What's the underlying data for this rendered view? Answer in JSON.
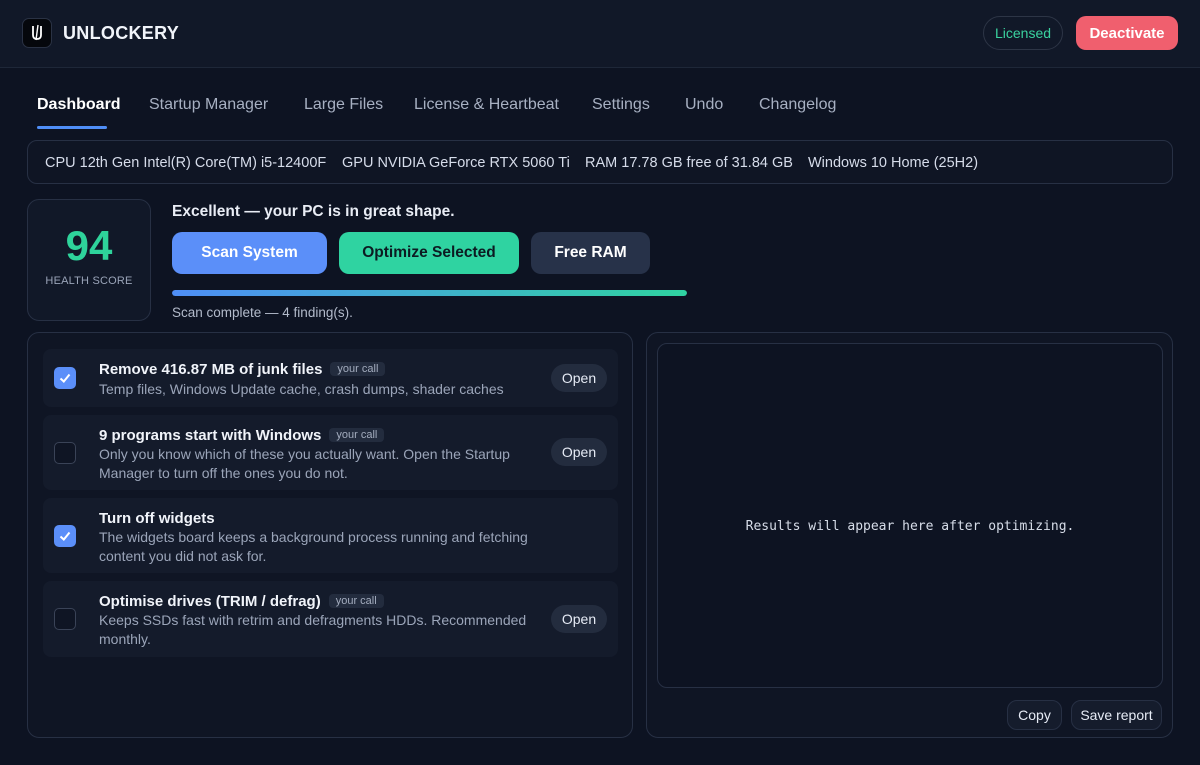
{
  "app": {
    "title": "UNLOCKERY",
    "license_status": "Licensed",
    "deactivate_label": "Deactivate",
    "colors": {
      "accent_blue": "#5b8ff9",
      "accent_green": "#2fd3a1",
      "danger": "#f05f6e",
      "background": "#0d1322"
    }
  },
  "tabs": [
    {
      "label": "Dashboard",
      "active": true
    },
    {
      "label": "Startup Manager",
      "active": false
    },
    {
      "label": "Large Files",
      "active": false
    },
    {
      "label": "License & Heartbeat",
      "active": false
    },
    {
      "label": "Settings",
      "active": false
    },
    {
      "label": "Undo",
      "active": false
    },
    {
      "label": "Changelog",
      "active": false
    }
  ],
  "system_info": {
    "cpu": "CPU  12th Gen Intel(R) Core(TM) i5-12400F",
    "gpu": "GPU  NVIDIA GeForce RTX 5060 Ti",
    "ram": "RAM  17.78 GB free of 31.84 GB",
    "os": "Windows 10 Home (25H2)"
  },
  "health": {
    "score": "94",
    "label": "HEALTH SCORE",
    "status_message": "Excellent — your PC is in great shape."
  },
  "actions": {
    "scan_label": "Scan System",
    "optimize_label": "Optimize Selected",
    "free_ram_label": "Free RAM"
  },
  "progress": {
    "fraction": 1.0,
    "status_text": "Scan complete — 4 finding(s)."
  },
  "findings": [
    {
      "title": "Remove 416.87 MB of junk files",
      "badge": "your call",
      "description": "Temp files, Windows Update cache, crash dumps, shader caches",
      "checked": true,
      "open_label": "Open"
    },
    {
      "title": "9 programs start with Windows",
      "badge": "your call",
      "description": "Only you know which of these you actually want. Open the Startup Manager to turn off the ones you do not.",
      "checked": false,
      "open_label": "Open"
    },
    {
      "title": "Turn off widgets",
      "badge": "",
      "description": "The widgets board keeps a background process running and fetching content you did not ask for.",
      "checked": true,
      "open_label": ""
    },
    {
      "title": "Optimise drives (TRIM / defrag)",
      "badge": "your call",
      "description": "Keeps SSDs fast with retrim and defragments HDDs. Recommended monthly.",
      "checked": false,
      "open_label": "Open"
    }
  ],
  "results": {
    "placeholder": "Results will appear here after optimizing.",
    "copy_label": "Copy",
    "save_label": "Save report"
  },
  "icons": {
    "logo": "unlockery-logo-icon",
    "check": "checkmark-icon"
  }
}
